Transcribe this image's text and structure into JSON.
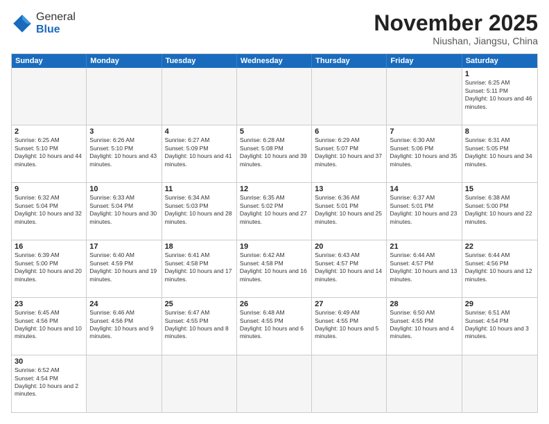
{
  "logo": {
    "general": "General",
    "blue": "Blue"
  },
  "header": {
    "month": "November 2025",
    "location": "Niushan, Jiangsu, China"
  },
  "weekdays": [
    "Sunday",
    "Monday",
    "Tuesday",
    "Wednesday",
    "Thursday",
    "Friday",
    "Saturday"
  ],
  "weeks": [
    [
      {
        "day": "",
        "empty": true
      },
      {
        "day": "",
        "empty": true
      },
      {
        "day": "",
        "empty": true
      },
      {
        "day": "",
        "empty": true
      },
      {
        "day": "",
        "empty": true
      },
      {
        "day": "",
        "empty": true
      },
      {
        "day": "1",
        "sunrise": "6:25 AM",
        "sunset": "5:11 PM",
        "daylight": "10 hours and 46 minutes."
      }
    ],
    [
      {
        "day": "2",
        "sunrise": "6:25 AM",
        "sunset": "5:10 PM",
        "daylight": "10 hours and 44 minutes."
      },
      {
        "day": "3",
        "sunrise": "6:26 AM",
        "sunset": "5:10 PM",
        "daylight": "10 hours and 43 minutes."
      },
      {
        "day": "4",
        "sunrise": "6:27 AM",
        "sunset": "5:09 PM",
        "daylight": "10 hours and 41 minutes."
      },
      {
        "day": "5",
        "sunrise": "6:28 AM",
        "sunset": "5:08 PM",
        "daylight": "10 hours and 39 minutes."
      },
      {
        "day": "6",
        "sunrise": "6:29 AM",
        "sunset": "5:07 PM",
        "daylight": "10 hours and 37 minutes."
      },
      {
        "day": "7",
        "sunrise": "6:30 AM",
        "sunset": "5:06 PM",
        "daylight": "10 hours and 35 minutes."
      },
      {
        "day": "8",
        "sunrise": "6:31 AM",
        "sunset": "5:05 PM",
        "daylight": "10 hours and 34 minutes."
      }
    ],
    [
      {
        "day": "9",
        "sunrise": "6:32 AM",
        "sunset": "5:04 PM",
        "daylight": "10 hours and 32 minutes."
      },
      {
        "day": "10",
        "sunrise": "6:33 AM",
        "sunset": "5:04 PM",
        "daylight": "10 hours and 30 minutes."
      },
      {
        "day": "11",
        "sunrise": "6:34 AM",
        "sunset": "5:03 PM",
        "daylight": "10 hours and 28 minutes."
      },
      {
        "day": "12",
        "sunrise": "6:35 AM",
        "sunset": "5:02 PM",
        "daylight": "10 hours and 27 minutes."
      },
      {
        "day": "13",
        "sunrise": "6:36 AM",
        "sunset": "5:01 PM",
        "daylight": "10 hours and 25 minutes."
      },
      {
        "day": "14",
        "sunrise": "6:37 AM",
        "sunset": "5:01 PM",
        "daylight": "10 hours and 23 minutes."
      },
      {
        "day": "15",
        "sunrise": "6:38 AM",
        "sunset": "5:00 PM",
        "daylight": "10 hours and 22 minutes."
      }
    ],
    [
      {
        "day": "16",
        "sunrise": "6:39 AM",
        "sunset": "5:00 PM",
        "daylight": "10 hours and 20 minutes."
      },
      {
        "day": "17",
        "sunrise": "6:40 AM",
        "sunset": "4:59 PM",
        "daylight": "10 hours and 19 minutes."
      },
      {
        "day": "18",
        "sunrise": "6:41 AM",
        "sunset": "4:58 PM",
        "daylight": "10 hours and 17 minutes."
      },
      {
        "day": "19",
        "sunrise": "6:42 AM",
        "sunset": "4:58 PM",
        "daylight": "10 hours and 16 minutes."
      },
      {
        "day": "20",
        "sunrise": "6:43 AM",
        "sunset": "4:57 PM",
        "daylight": "10 hours and 14 minutes."
      },
      {
        "day": "21",
        "sunrise": "6:44 AM",
        "sunset": "4:57 PM",
        "daylight": "10 hours and 13 minutes."
      },
      {
        "day": "22",
        "sunrise": "6:44 AM",
        "sunset": "4:56 PM",
        "daylight": "10 hours and 12 minutes."
      }
    ],
    [
      {
        "day": "23",
        "sunrise": "6:45 AM",
        "sunset": "4:56 PM",
        "daylight": "10 hours and 10 minutes."
      },
      {
        "day": "24",
        "sunrise": "6:46 AM",
        "sunset": "4:56 PM",
        "daylight": "10 hours and 9 minutes."
      },
      {
        "day": "25",
        "sunrise": "6:47 AM",
        "sunset": "4:55 PM",
        "daylight": "10 hours and 8 minutes."
      },
      {
        "day": "26",
        "sunrise": "6:48 AM",
        "sunset": "4:55 PM",
        "daylight": "10 hours and 6 minutes."
      },
      {
        "day": "27",
        "sunrise": "6:49 AM",
        "sunset": "4:55 PM",
        "daylight": "10 hours and 5 minutes."
      },
      {
        "day": "28",
        "sunrise": "6:50 AM",
        "sunset": "4:55 PM",
        "daylight": "10 hours and 4 minutes."
      },
      {
        "day": "29",
        "sunrise": "6:51 AM",
        "sunset": "4:54 PM",
        "daylight": "10 hours and 3 minutes."
      }
    ],
    [
      {
        "day": "30",
        "sunrise": "6:52 AM",
        "sunset": "4:54 PM",
        "daylight": "10 hours and 2 minutes."
      },
      {
        "day": "",
        "empty": true
      },
      {
        "day": "",
        "empty": true
      },
      {
        "day": "",
        "empty": true
      },
      {
        "day": "",
        "empty": true
      },
      {
        "day": "",
        "empty": true
      },
      {
        "day": "",
        "empty": true
      }
    ]
  ]
}
